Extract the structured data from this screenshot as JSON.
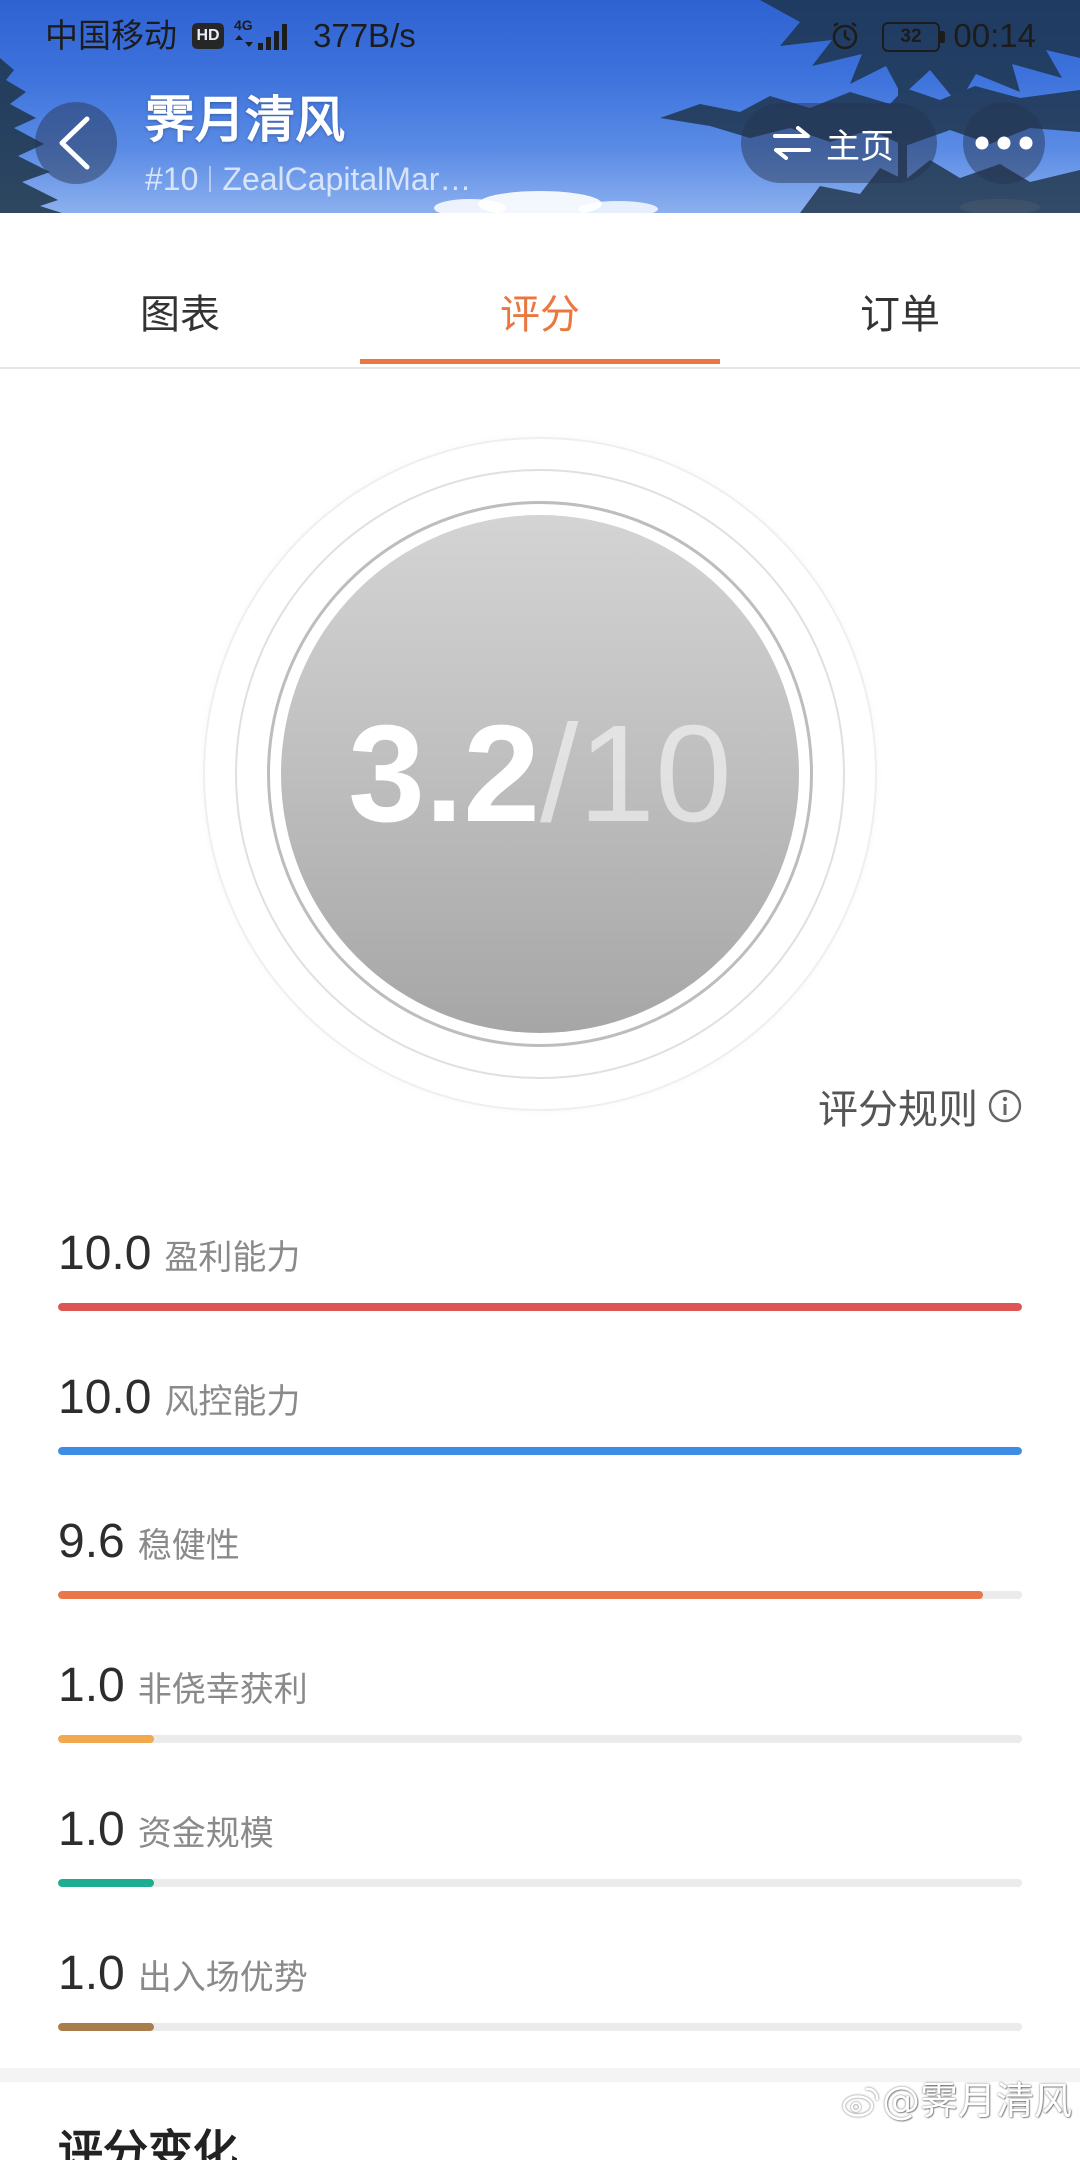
{
  "status_bar": {
    "carrier": "中国移动",
    "hd_badge": "HD",
    "network": "4G",
    "speed": "377B/s",
    "battery": "32",
    "time": "00:14",
    "icons": [
      "signal-bars-icon",
      "alarm-icon",
      "battery-icon"
    ]
  },
  "header": {
    "title": "霁月清风",
    "rank": "#10",
    "account": "ZealCapitalMar…",
    "home_label": "主页",
    "icons": {
      "back": "chevron-left-icon",
      "home": "swap-arrows-icon",
      "more": "more-dots-icon"
    }
  },
  "tabs": [
    {
      "label": "图表",
      "active": false
    },
    {
      "label": "评分",
      "active": true
    },
    {
      "label": "订单",
      "active": false
    }
  ],
  "score": {
    "value": "3.2",
    "max": "/10"
  },
  "rules": {
    "label": "评分规则",
    "icon": "info-icon"
  },
  "metrics": [
    {
      "value": "10.0",
      "label": "盈利能力",
      "fill": 1.0,
      "color": "#DE5653"
    },
    {
      "value": "10.0",
      "label": "风控能力",
      "fill": 1.0,
      "color": "#3F8CE6"
    },
    {
      "value": "9.6",
      "label": "稳健性",
      "fill": 0.96,
      "color": "#E9774A"
    },
    {
      "value": "1.0",
      "label": "非侥幸获利",
      "fill": 0.1,
      "color": "#F2A84D"
    },
    {
      "value": "1.0",
      "label": "资金规模",
      "fill": 0.1,
      "color": "#1DAD91"
    },
    {
      "value": "1.0",
      "label": "出入场优势",
      "fill": 0.1,
      "color": "#A97E4C"
    }
  ],
  "section_title": "评分变化",
  "watermark": {
    "text": "@霁月清风",
    "icon": "weibo-logo-icon"
  },
  "colors": {
    "accent": "#E9773F",
    "track": "#EBEBEB",
    "score_disc_top": "#D4D4D4",
    "score_disc_bottom": "#A6A6A6"
  }
}
